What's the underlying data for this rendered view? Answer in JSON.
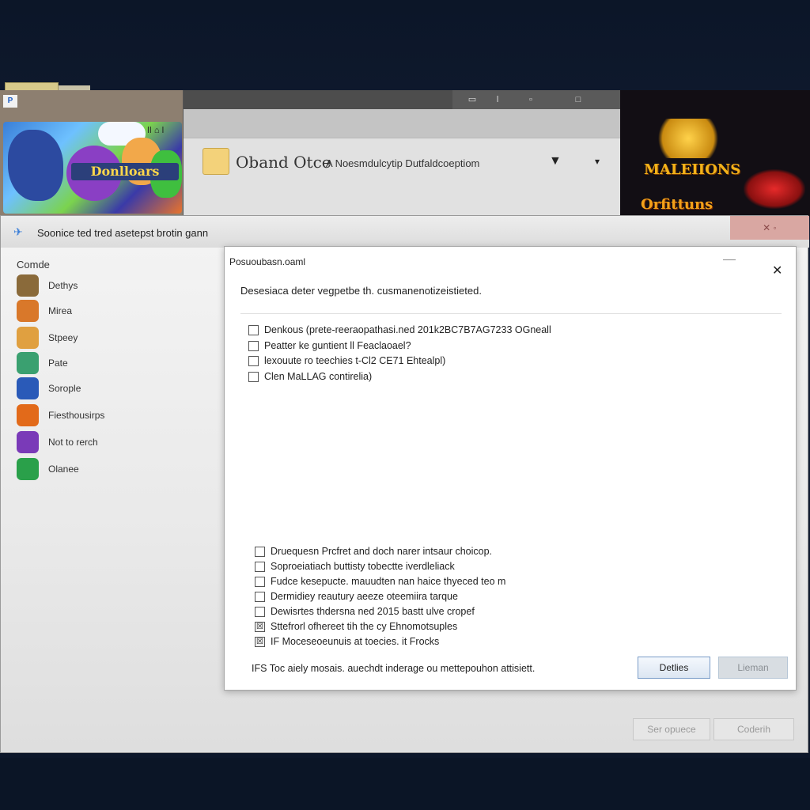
{
  "thumbnail": {
    "title": "Donlloars",
    "dots": "⠀ǀǀ ⌂ ǀ"
  },
  "top_window": {
    "app_name": "Oband Otce",
    "app_desc": "A Noesmdulcytip Dutfaldcoeptiom"
  },
  "right_art": {
    "logo_top": "MALEIIONS",
    "logo_bottom": "Orfittuns"
  },
  "main_window": {
    "title": "Soonice  ted    tred asetepst brotin gann",
    "close_label": "✕ ◦"
  },
  "sidebar": {
    "heading": "Comde",
    "items": [
      {
        "label": "Dethys",
        "color": "#8a6a3a"
      },
      {
        "label": "Mirea",
        "color": "#d9782a"
      },
      {
        "label": "Stpeey",
        "color": "#e0a040"
      },
      {
        "label": "Pate",
        "color": "#3aa070"
      },
      {
        "label": "Sorople",
        "color": "#2a5ab8"
      },
      {
        "label": "Fiesthousirps",
        "color": "#e26a1a"
      },
      {
        "label": "Not to rerch",
        "color": "#7a3ab8"
      },
      {
        "label": "Olanee",
        "color": "#2aa04a"
      }
    ]
  },
  "dialog": {
    "title": "Posuoubasn.oaml",
    "message": "Desesiaca deter vegpetbe th. cusmanenotizeistieted.",
    "close_icon": "✕",
    "options_top": [
      {
        "label": "Denkous (prete-reeraopathasi.ned 201k2BC7B7AG7233 OGneall",
        "checked": false
      },
      {
        "label": "Peatter ke guntient ll Feaclaoael?",
        "checked": false
      },
      {
        "label": "lexouute ro teechies t-Cl2 CE71 Ehtealpl)",
        "checked": false
      },
      {
        "label": "Clen MaLLAG contirelia)",
        "checked": false
      }
    ],
    "options_bottom": [
      {
        "label": "Druequesn Prcfret and doch narer intsaur choicop.",
        "checked": false
      },
      {
        "label": "Soproeiatiach buttisty tobectte iverdleliack",
        "checked": false
      },
      {
        "label": "Fudce kesepucte. mauudten nan haice thyeced teo m",
        "checked": false
      },
      {
        "label": "Dermidiey reautury aeeze oteemiira tarque",
        "checked": false
      },
      {
        "label": "Dewisrtes thdersna ned 2015 bastt ulve cropef",
        "checked": false
      },
      {
        "label": "Sttefrorl ofhereet tih the cy Ehnomotsuples",
        "checked": true
      },
      {
        "label": "IF  Moceseoeunuis at toecies. it Frocks",
        "checked": true
      }
    ],
    "footer": "IFS  Toc aiely mosais. auechdt inderage ou mettepouhon attisiett.",
    "btn_primary": "Detlies",
    "btn_secondary": "Lieman"
  },
  "outer_buttons": {
    "btn_left": "Ser opuece",
    "btn_right": "Coderih"
  }
}
